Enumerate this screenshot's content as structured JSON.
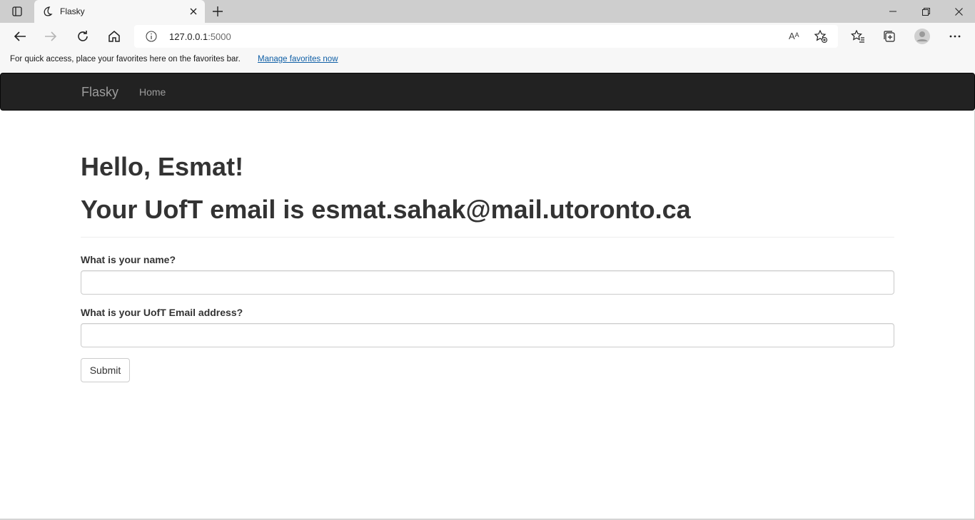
{
  "browser": {
    "tab_title": "Flasky",
    "url_host": "127.0.0.1",
    "url_port": ":5000",
    "read_aloud_label": "Aᴬ",
    "favorites_bar_message": "For quick access, place your favorites here on the favorites bar.",
    "favorites_bar_link": "Manage favorites now"
  },
  "navbar": {
    "brand": "Flasky",
    "links": [
      {
        "label": "Home"
      }
    ]
  },
  "main": {
    "greeting": "Hello, Esmat!",
    "email_line": "Your UofT email is esmat.sahak@mail.utoronto.ca",
    "form": {
      "name_label": "What is your name?",
      "name_value": "",
      "email_label": "What is your UofT Email address?",
      "email_value": "",
      "submit_label": "Submit"
    }
  },
  "colors": {
    "navbar_bg": "#222222",
    "navbar_text": "#9d9d9d",
    "link_blue": "#0f5fa6",
    "chrome_bg": "#f7f7f7",
    "tabstrip_bg": "#cecece"
  },
  "icons": [
    "tab-actions-icon",
    "flasky-favicon",
    "close-tab-icon",
    "new-tab-icon",
    "minimize-icon",
    "maximize-icon",
    "close-window-icon",
    "back-arrow-icon",
    "forward-arrow-icon",
    "refresh-icon",
    "home-icon",
    "site-info-icon",
    "add-favorite-icon",
    "favorites-icon",
    "collections-icon",
    "profile-avatar-icon",
    "more-menu-icon"
  ]
}
